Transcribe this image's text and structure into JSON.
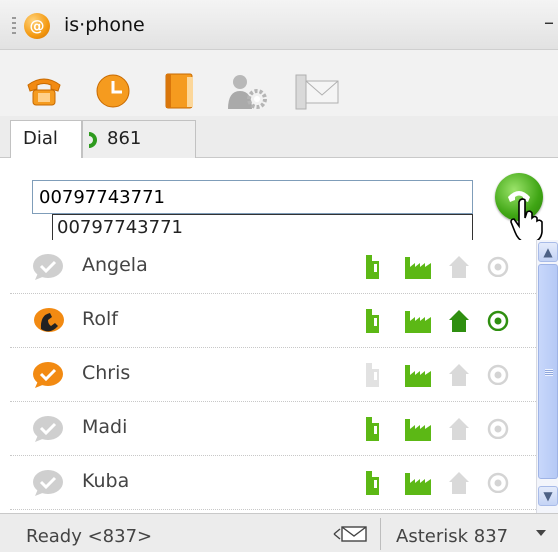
{
  "window": {
    "title": "is·phone",
    "logo_glyph": "@",
    "minimize_glyph": "–"
  },
  "toolbar": {
    "icons": [
      "phone-icon",
      "clock-icon",
      "address-book-icon",
      "settings-user-icon",
      "email-icon"
    ]
  },
  "tabs": [
    {
      "label": "Dial",
      "active": true
    },
    {
      "label": "861",
      "active": false,
      "icon": "phone-call-icon"
    }
  ],
  "dial": {
    "number": "00797743771",
    "suggestion": "00797743771"
  },
  "contacts": [
    {
      "name": "Angela",
      "status": "offline",
      "mobile": true,
      "work": true,
      "home": false,
      "online": false
    },
    {
      "name": "Rolf",
      "status": "on-call",
      "mobile": true,
      "work": true,
      "home": true,
      "online": true
    },
    {
      "name": "Chris",
      "status": "available",
      "mobile": false,
      "work": true,
      "home": false,
      "online": false
    },
    {
      "name": "Madi",
      "status": "offline",
      "mobile": true,
      "work": true,
      "home": false,
      "online": false
    },
    {
      "name": "Kuba",
      "status": "offline",
      "mobile": true,
      "work": true,
      "home": false,
      "online": false
    }
  ],
  "statusbar": {
    "status": "Ready <837>",
    "server": "Asterisk 837"
  },
  "colors": {
    "green": "#3fa514",
    "orange": "#f49a12",
    "grey": "#c8c8c8"
  }
}
